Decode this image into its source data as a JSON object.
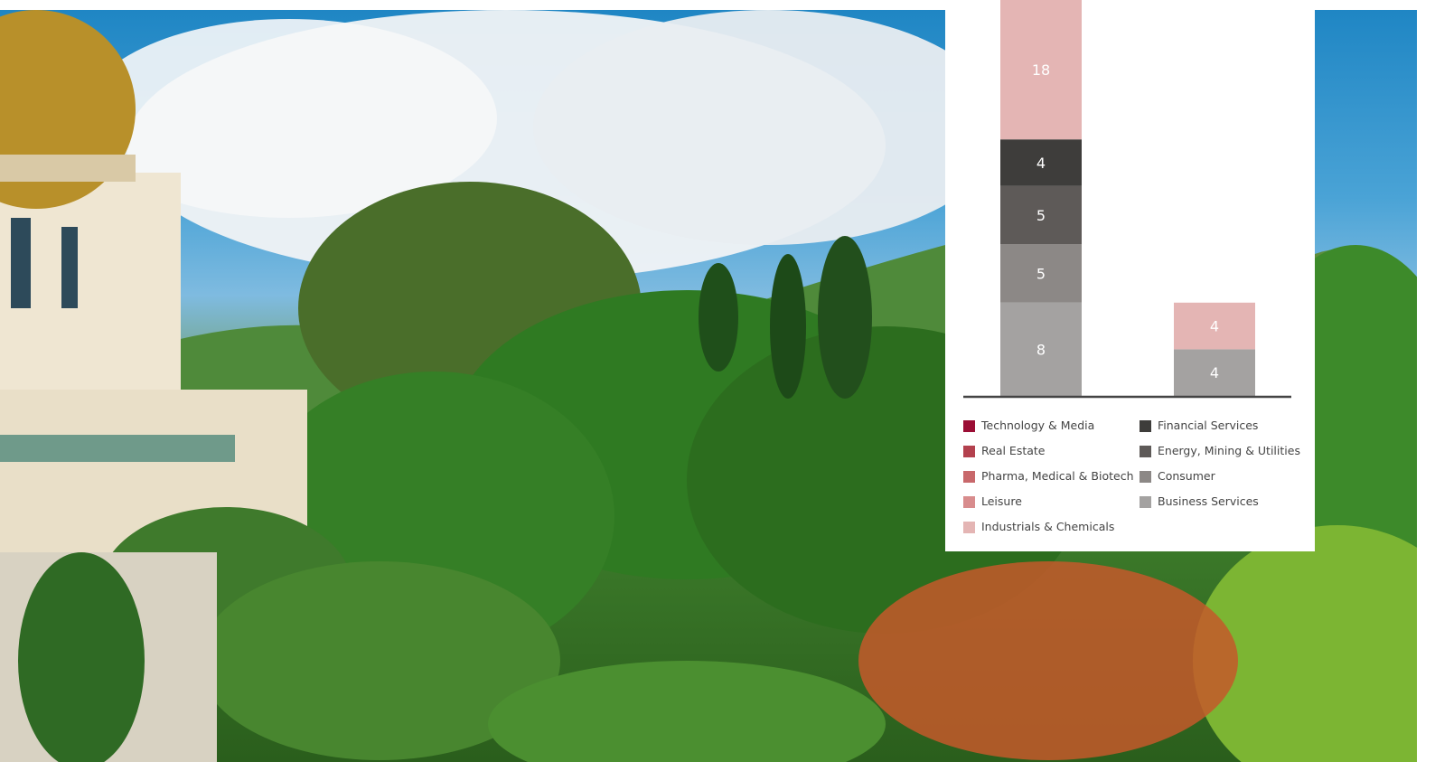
{
  "chart_data": {
    "type": "bar",
    "stacked": true,
    "categories": [
      "",
      ""
    ],
    "series": [
      {
        "name": "Business Services",
        "values": [
          8,
          4
        ],
        "color": "#a4a2a1"
      },
      {
        "name": "Consumer",
        "values": [
          5,
          0
        ],
        "color": "#8c8886"
      },
      {
        "name": "Energy, Mining & Utilities",
        "values": [
          5,
          0
        ],
        "color": "#5e5a58"
      },
      {
        "name": "Financial Services",
        "values": [
          4,
          0
        ],
        "color": "#3e3d3b"
      },
      {
        "name": "Industrials & Chemicals",
        "values": [
          18,
          4
        ],
        "color": "#e4b5b4"
      }
    ],
    "bar_labels": [
      [
        "8",
        "5",
        "5",
        "4",
        "18"
      ],
      [
        "4",
        "4"
      ]
    ],
    "legend": {
      "placement": "bottom",
      "columns": [
        [
          {
            "label": "Technology & Media",
            "color": "#9b0e35"
          },
          {
            "label": "Real Estate",
            "color": "#b3414e"
          },
          {
            "label": "Pharma, Medical & Biotech",
            "color": "#c8686b"
          },
          {
            "label": "Leisure",
            "color": "#d88c8d"
          },
          {
            "label": "Industrials & Chemicals",
            "color": "#e4b5b4"
          }
        ],
        [
          {
            "label": "Financial Services",
            "color": "#3e3d3b"
          },
          {
            "label": "Energy, Mining & Utilities",
            "color": "#5e5a58"
          },
          {
            "label": "Consumer",
            "color": "#8c8886"
          },
          {
            "label": "Business Services",
            "color": "#a4a2a1"
          }
        ]
      ]
    },
    "grid": false,
    "axis_color": "#444444"
  },
  "background": {
    "description_icon": "photo-garden-icon",
    "colors": {
      "sky": "#1f86c4",
      "cloud": "#f2f4f6",
      "foliage": "#3c7a2a",
      "dome": "#b8902a",
      "building": "#efe6d2",
      "flowers": "#d8502a"
    }
  }
}
